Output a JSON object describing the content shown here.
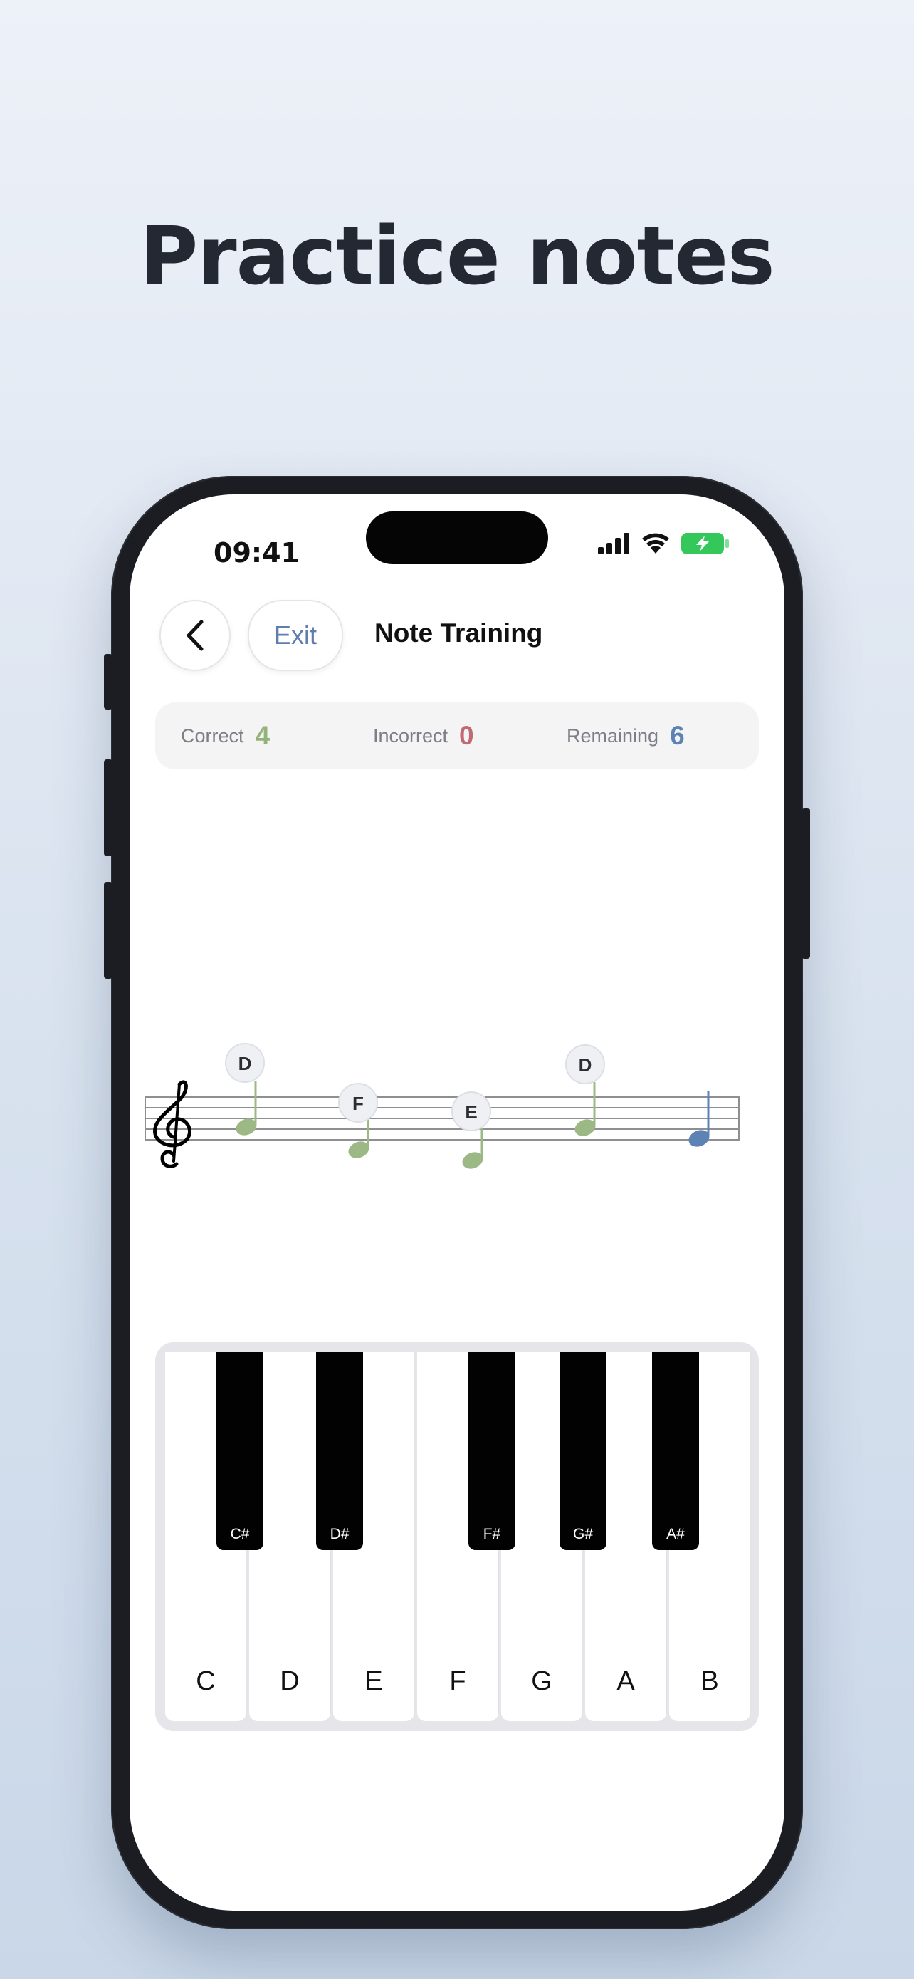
{
  "headline": "Practice notes",
  "status_bar": {
    "time": "09:41"
  },
  "nav": {
    "exit_label": "Exit",
    "title": "Note Training"
  },
  "stats": {
    "correct": {
      "label": "Correct",
      "value": "4",
      "color": "#94b37a"
    },
    "incorrect": {
      "label": "Incorrect",
      "value": "0",
      "color": "#c26a73"
    },
    "remaining": {
      "label": "Remaining",
      "value": "6",
      "color": "#5d82b4"
    }
  },
  "staff": {
    "clef": "treble-clef-icon",
    "note_labels": [
      "D",
      "F",
      "E",
      "D"
    ],
    "answered_note_color": "#9cb985",
    "current_note_color": "#5d82b4"
  },
  "piano": {
    "white_keys": [
      "C",
      "D",
      "E",
      "F",
      "G",
      "A",
      "B"
    ],
    "black_keys": [
      "C#",
      "D#",
      "F#",
      "G#",
      "A#"
    ]
  },
  "colors": {
    "accent": "#5e7fae",
    "battery": "#34c759"
  }
}
